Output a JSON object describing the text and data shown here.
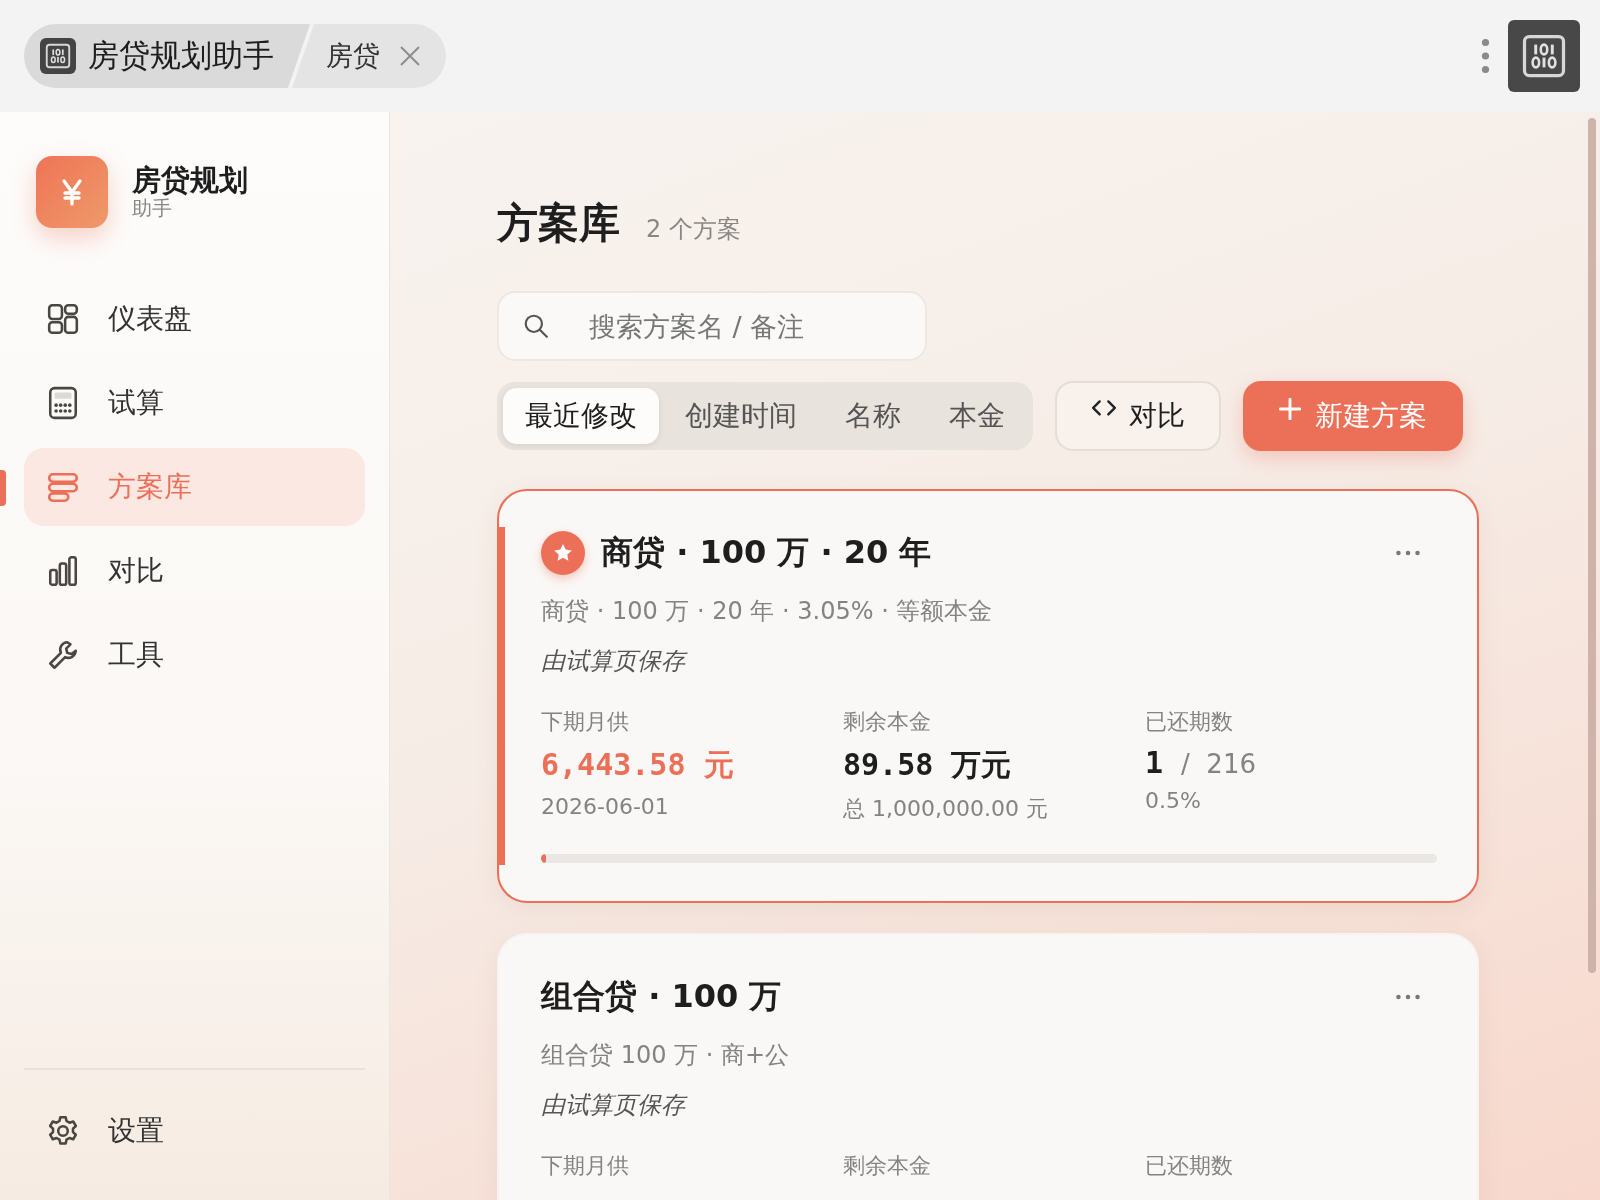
{
  "tabbar": {
    "app_tab": "房贷规划助手",
    "doc_tab": "房贷"
  },
  "sidebar": {
    "brand": {
      "title": "房贷规划",
      "subtitle": "助手"
    },
    "items": [
      {
        "label": "仪表盘",
        "kind": "grid",
        "selected": false
      },
      {
        "label": "试算",
        "kind": "calculator",
        "selected": false
      },
      {
        "label": "方案库",
        "kind": "stack",
        "selected": true
      },
      {
        "label": "对比",
        "kind": "bars",
        "selected": false
      },
      {
        "label": "工具",
        "kind": "wrench",
        "selected": false
      }
    ],
    "footer_item": {
      "label": "设置",
      "kind": "gear",
      "selected": false
    }
  },
  "main": {
    "title": "方案库",
    "count": "2 个方案",
    "search": {
      "placeholder": "搜索方案名 / 备注"
    },
    "sort_options": [
      {
        "label": "最近修改",
        "selected": true
      },
      {
        "label": "创建时间",
        "selected": false
      },
      {
        "label": "名称",
        "selected": false
      },
      {
        "label": "本金",
        "selected": false
      }
    ],
    "compare_button": "对比",
    "new_button": "新建方案",
    "plans": [
      {
        "title": "商贷 · 100 万 · 20 年",
        "starred": true,
        "selected": true,
        "summary": "商贷 · 100 万 · 20 年 · 3.05% · 等额本金",
        "note": "由试算页保存",
        "stats": [
          {
            "kind": "amount",
            "label": "下期月供",
            "value": "6,443.58",
            "unit": "元",
            "accent": true,
            "sub": "2026-06-01"
          },
          {
            "kind": "amount",
            "label": "剩余本金",
            "value": "89.58",
            "unit": "万元",
            "accent": false,
            "sub": "总 1,000,000.00 元"
          },
          {
            "kind": "count",
            "label": "已还期数",
            "value": "1",
            "unit": "/  216",
            "sub": "0.5%"
          }
        ],
        "level": 0.005
      },
      {
        "title": "组合贷 · 100 万",
        "starred": false,
        "selected": false,
        "summary": "组合贷 100 万 · 商+公",
        "note": "由试算页保存",
        "stats": [
          {
            "kind": "amount",
            "label": "下期月供"
          },
          {
            "kind": "amount",
            "label": "剩余本金"
          },
          {
            "kind": "count",
            "label": "已还期数"
          }
        ]
      }
    ]
  }
}
